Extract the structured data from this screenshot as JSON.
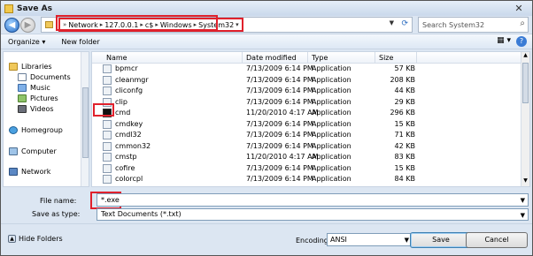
{
  "window": {
    "title": "Save As"
  },
  "address": {
    "crumbs": [
      "Network",
      "127.0.0.1",
      "c$",
      "Windows",
      "System32"
    ]
  },
  "search": {
    "placeholder": "Search System32"
  },
  "toolbar": {
    "organize": "Organize",
    "new_folder": "New folder"
  },
  "nav": {
    "items": [
      {
        "label": "Libraries",
        "icon": "libraries-icon"
      },
      {
        "label": "Documents",
        "icon": "documents-icon"
      },
      {
        "label": "Music",
        "icon": "music-icon"
      },
      {
        "label": "Pictures",
        "icon": "pictures-icon"
      },
      {
        "label": "Videos",
        "icon": "videos-icon"
      },
      {
        "label": "Homegroup",
        "icon": "homegroup-icon"
      },
      {
        "label": "Computer",
        "icon": "computer-icon"
      },
      {
        "label": "Network",
        "icon": "network-icon"
      }
    ]
  },
  "columns": {
    "name": "Name",
    "date": "Date modified",
    "type": "Type",
    "size": "Size"
  },
  "files": [
    {
      "name": "bpmcr",
      "date": "7/13/2009 6:14 PM",
      "type": "Application",
      "size": "57 KB"
    },
    {
      "name": "cleanmgr",
      "date": "7/13/2009 6:14 PM",
      "type": "Application",
      "size": "208 KB"
    },
    {
      "name": "cliconfg",
      "date": "7/13/2009 6:14 PM",
      "type": "Application",
      "size": "44 KB"
    },
    {
      "name": "clip",
      "date": "7/13/2009 6:14 PM",
      "type": "Application",
      "size": "29 KB"
    },
    {
      "name": "cmd",
      "date": "11/20/2010 4:17 AM",
      "type": "Application",
      "size": "296 KB"
    },
    {
      "name": "cmdkey",
      "date": "7/13/2009 6:14 PM",
      "type": "Application",
      "size": "15 KB"
    },
    {
      "name": "cmdl32",
      "date": "7/13/2009 6:14 PM",
      "type": "Application",
      "size": "71 KB"
    },
    {
      "name": "cmmon32",
      "date": "7/13/2009 6:14 PM",
      "type": "Application",
      "size": "42 KB"
    },
    {
      "name": "cmstp",
      "date": "11/20/2010 4:17 AM",
      "type": "Application",
      "size": "83 KB"
    },
    {
      "name": "cofire",
      "date": "7/13/2009 6:14 PM",
      "type": "Application",
      "size": "15 KB"
    },
    {
      "name": "colorcpl",
      "date": "7/13/2009 6:14 PM",
      "type": "Application",
      "size": "84 KB"
    }
  ],
  "filename": {
    "label": "File name:",
    "value": "*.exe"
  },
  "save_as_type": {
    "label": "Save as type:",
    "value": "Text Documents (*.txt)"
  },
  "hide_folders": "Hide Folders",
  "encoding": {
    "label": "Encoding:",
    "value": "ANSI"
  },
  "buttons": {
    "save": "Save",
    "cancel": "Cancel"
  },
  "colors": {
    "highlight": "#e0212c",
    "accent": "#2a6fc7"
  }
}
